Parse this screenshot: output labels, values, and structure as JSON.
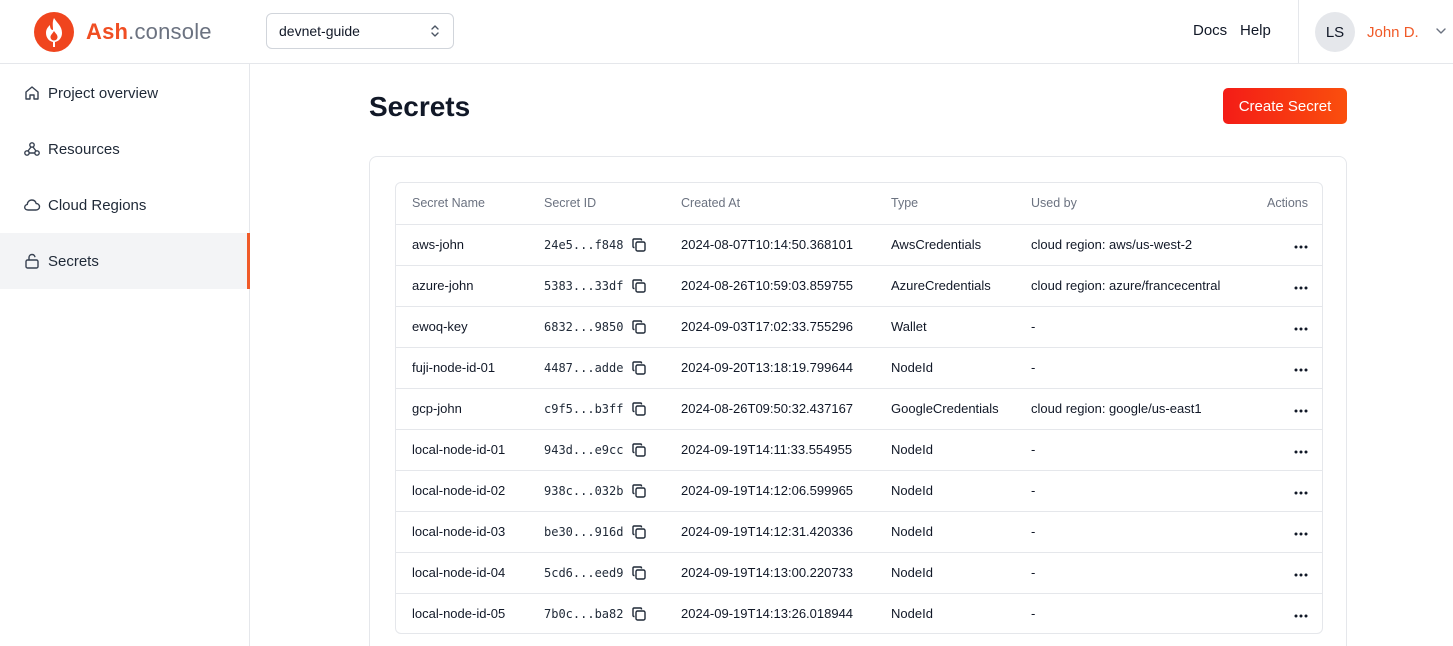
{
  "header": {
    "brand_primary": "Ash",
    "brand_secondary": ".console",
    "project": "devnet-guide",
    "links": {
      "docs": "Docs",
      "help": "Help"
    },
    "user": {
      "initials": "LS",
      "name": "John D."
    }
  },
  "sidebar": {
    "items": [
      {
        "label": "Project overview",
        "icon": "home-icon",
        "active": false
      },
      {
        "label": "Resources",
        "icon": "webhook-icon",
        "active": false
      },
      {
        "label": "Cloud Regions",
        "icon": "cloud-icon",
        "active": false
      },
      {
        "label": "Secrets",
        "icon": "lock-open-icon",
        "active": true
      }
    ]
  },
  "main": {
    "title": "Secrets",
    "create_button": "Create Secret",
    "table": {
      "columns": [
        "Secret Name",
        "Secret ID",
        "Created At",
        "Type",
        "Used by",
        "Actions"
      ],
      "rows": [
        {
          "name": "aws-john",
          "id": "24e5...f848",
          "created": "2024-08-07T10:14:50.368101",
          "type": "AwsCredentials",
          "used_by": "cloud region: aws/us-west-2"
        },
        {
          "name": "azure-john",
          "id": "5383...33df",
          "created": "2024-08-26T10:59:03.859755",
          "type": "AzureCredentials",
          "used_by": "cloud region: azure/francecentral"
        },
        {
          "name": "ewoq-key",
          "id": "6832...9850",
          "created": "2024-09-03T17:02:33.755296",
          "type": "Wallet",
          "used_by": "-"
        },
        {
          "name": "fuji-node-id-01",
          "id": "4487...adde",
          "created": "2024-09-20T13:18:19.799644",
          "type": "NodeId",
          "used_by": "-"
        },
        {
          "name": "gcp-john",
          "id": "c9f5...b3ff",
          "created": "2024-08-26T09:50:32.437167",
          "type": "GoogleCredentials",
          "used_by": "cloud region: google/us-east1"
        },
        {
          "name": "local-node-id-01",
          "id": "943d...e9cc",
          "created": "2024-09-19T14:11:33.554955",
          "type": "NodeId",
          "used_by": "-"
        },
        {
          "name": "local-node-id-02",
          "id": "938c...032b",
          "created": "2024-09-19T14:12:06.599965",
          "type": "NodeId",
          "used_by": "-"
        },
        {
          "name": "local-node-id-03",
          "id": "be30...916d",
          "created": "2024-09-19T14:12:31.420336",
          "type": "NodeId",
          "used_by": "-"
        },
        {
          "name": "local-node-id-04",
          "id": "5cd6...eed9",
          "created": "2024-09-19T14:13:00.220733",
          "type": "NodeId",
          "used_by": "-"
        },
        {
          "name": "local-node-id-05",
          "id": "7b0c...ba82",
          "created": "2024-09-19T14:13:26.018944",
          "type": "NodeId",
          "used_by": "-"
        }
      ]
    }
  },
  "colors": {
    "accent": "#f05a28",
    "button_start": "#f41c17",
    "button_end": "#fa4f0d"
  }
}
